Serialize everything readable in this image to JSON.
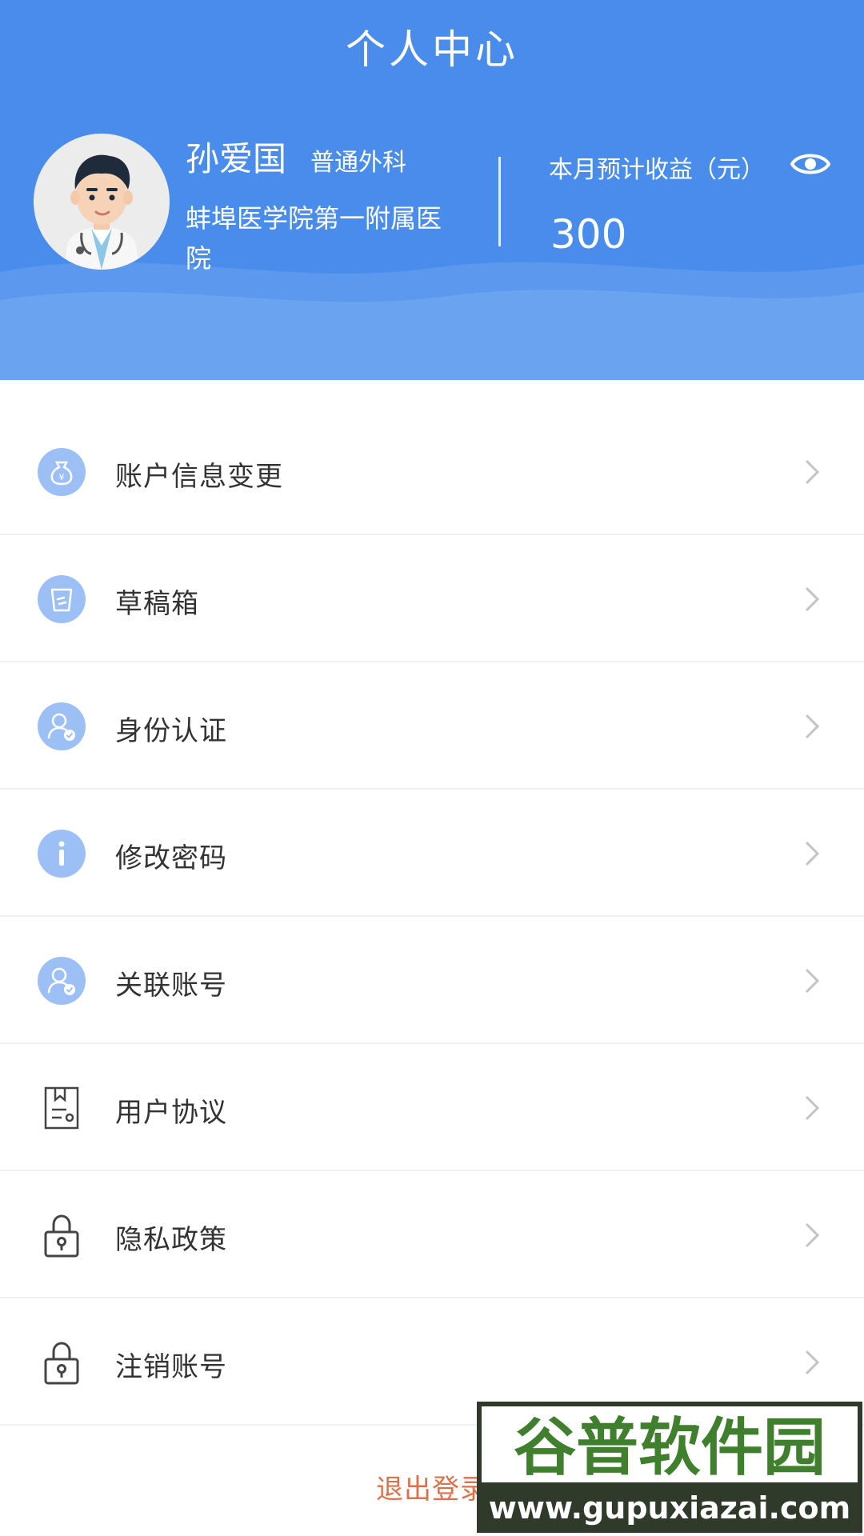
{
  "header": {
    "title": "个人中心",
    "user_name": "孙爱国",
    "department": "普通外科",
    "hospital": "蚌埠医学院第一附属医院",
    "income_label": "本月预计收益（元）",
    "income_value": "300",
    "background_color": "#4a8ceb"
  },
  "menu": {
    "items": [
      {
        "label": "账户信息变更",
        "icon": "money-bag-icon"
      },
      {
        "label": "草稿箱",
        "icon": "trash-bin-icon"
      },
      {
        "label": "身份认证",
        "icon": "user-verified-icon"
      },
      {
        "label": "修改密码",
        "icon": "info-icon"
      },
      {
        "label": "关联账号",
        "icon": "user-verified-icon"
      },
      {
        "label": "用户协议",
        "icon": "document-icon"
      },
      {
        "label": "隐私政策",
        "icon": "lock-icon"
      },
      {
        "label": "注销账号",
        "icon": "lock-icon"
      }
    ]
  },
  "logout": {
    "label": "退出登录",
    "color": "#e0704a"
  },
  "watermark": {
    "text": "谷普软件园",
    "url_text": "www.gupuxiazai.com"
  }
}
